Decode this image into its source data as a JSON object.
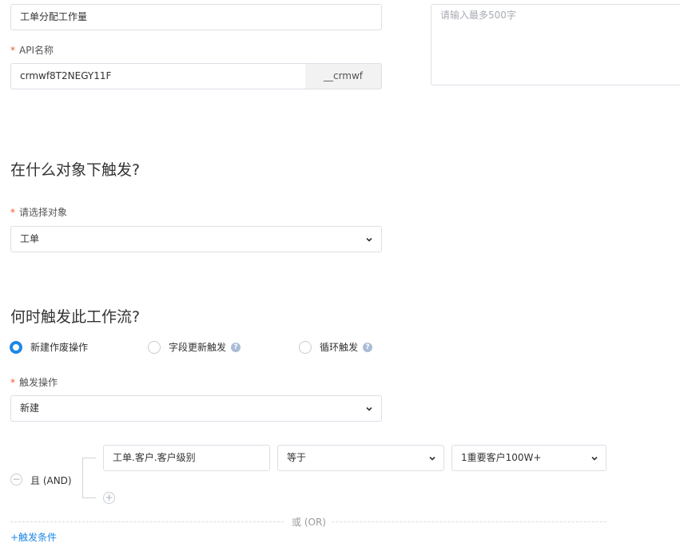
{
  "basic": {
    "name_value": "工单分配工作量",
    "api_label": "API名称",
    "api_value": "crmwf8T2NEGY11F",
    "api_suffix": "__crmwf",
    "description_placeholder": "请输入最多500字"
  },
  "object_section": {
    "title": "在什么对象下触发?",
    "select_label": "请选择对象",
    "select_value": "工单"
  },
  "trigger_section": {
    "title": "何时触发此工作流?",
    "options": [
      {
        "label": "新建作废操作",
        "checked": true,
        "help": false
      },
      {
        "label": "字段更新触发",
        "checked": false,
        "help": true
      },
      {
        "label": "循环触发",
        "checked": false,
        "help": true
      }
    ],
    "action_label": "触发操作",
    "action_value": "新建"
  },
  "conditions": {
    "logic_label": "且 (AND)",
    "field_value": "工单.客户.客户级别",
    "operator_value": "等于",
    "target_value": "1重要客户100W+",
    "or_label": "或 (OR)",
    "add_condition_label": "+触发条件"
  },
  "icons": {
    "chevron": "chevron-down-icon",
    "help": "help-icon",
    "remove": "minus-circle-icon",
    "add": "plus-circle-icon"
  },
  "colors": {
    "accent": "#1e88e5",
    "required": "#f05a28"
  }
}
